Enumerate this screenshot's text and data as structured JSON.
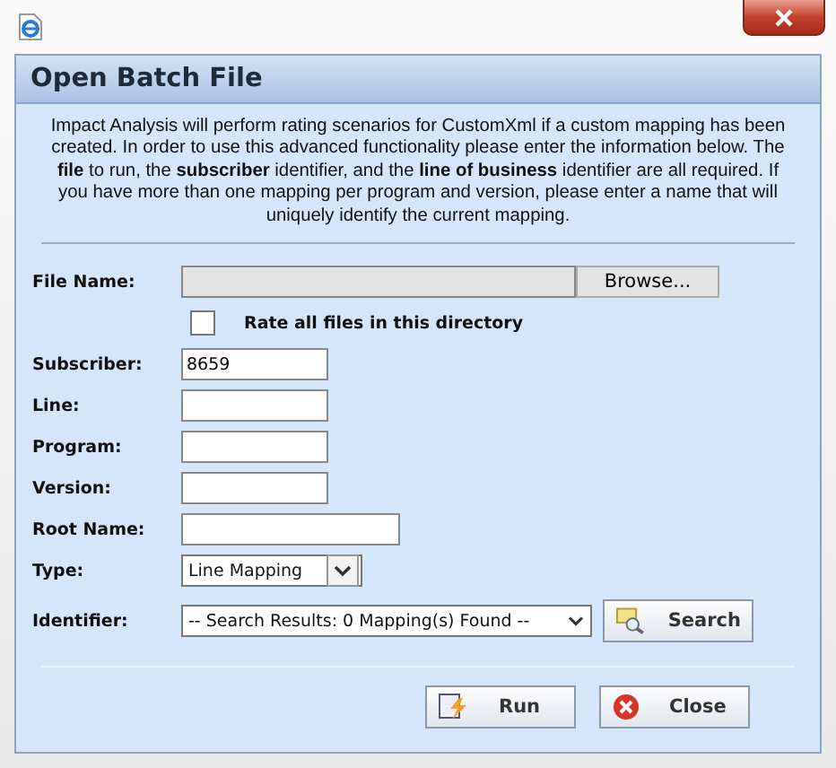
{
  "dialog": {
    "title": "Open Batch File",
    "description": "Impact Analysis will perform rating scenarios for CustomXml if a custom mapping has been created. In order to use this advanced functionality please enter the information below. The **file** to run, the **subscriber** identifier, and the **line of business** identifier are all required. If you have more than one mapping per program and version, please enter a name that will uniquely identify the current mapping.",
    "file_name": {
      "label": "File Name:",
      "browse": "Browse..."
    },
    "rate_all": {
      "label": "Rate all files in this directory",
      "checked": false
    },
    "fields": [
      {
        "label": "Subscriber:",
        "value": "8659",
        "kind": "short"
      },
      {
        "label": "Line:",
        "kind": "short"
      },
      {
        "label": "Program:",
        "kind": "short"
      },
      {
        "label": "Version:",
        "kind": "short"
      },
      {
        "label": "Root Name:",
        "kind": "long"
      }
    ],
    "type": {
      "label": "Type:",
      "value": "Line Mapping"
    },
    "identifier": {
      "label": "Identifier:",
      "value": "-- Search Results: 0 Mapping(s) Found --",
      "search": "Search"
    },
    "buttons": [
      {
        "label": "Run",
        "kind": "run"
      },
      {
        "label": "Close",
        "kind": "close"
      }
    ]
  }
}
